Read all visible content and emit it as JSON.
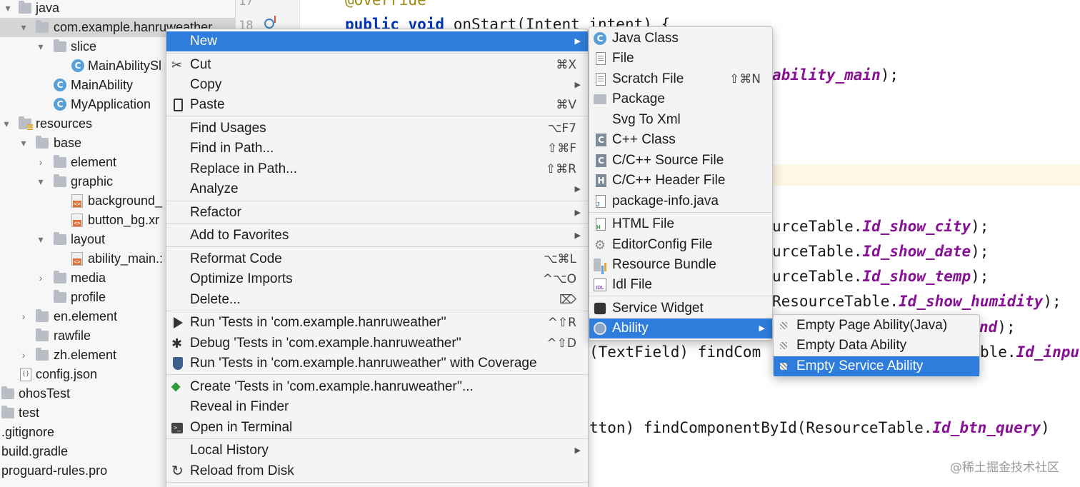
{
  "tree": {
    "items": [
      {
        "label": "java",
        "icon": "folder-icon",
        "arrow": "▾"
      },
      {
        "label": "com.example.hanruweather",
        "icon": "package-icon",
        "arrow": "▾"
      },
      {
        "label": "slice",
        "icon": "package-icon",
        "arrow": "▾"
      },
      {
        "label": "MainAbilitySl",
        "icon": "class-icon",
        "arrow": ""
      },
      {
        "label": "MainAbility",
        "icon": "class-icon",
        "arrow": ""
      },
      {
        "label": "MyApplication",
        "icon": "class-icon",
        "arrow": ""
      },
      {
        "label": "resources",
        "icon": "resources-folder-icon",
        "arrow": "▾"
      },
      {
        "label": "base",
        "icon": "folder-icon",
        "arrow": "▾"
      },
      {
        "label": "element",
        "icon": "folder-icon",
        "arrow": "›"
      },
      {
        "label": "graphic",
        "icon": "folder-icon",
        "arrow": "▾"
      },
      {
        "label": "background_",
        "icon": "xml-file-icon",
        "arrow": ""
      },
      {
        "label": "button_bg.xr",
        "icon": "xml-file-icon",
        "arrow": ""
      },
      {
        "label": "layout",
        "icon": "folder-icon",
        "arrow": "▾"
      },
      {
        "label": "ability_main.:",
        "icon": "xml-file-icon",
        "arrow": ""
      },
      {
        "label": "media",
        "icon": "folder-icon",
        "arrow": "›"
      },
      {
        "label": "profile",
        "icon": "folder-icon",
        "arrow": ""
      },
      {
        "label": "en.element",
        "icon": "folder-icon",
        "arrow": "›"
      },
      {
        "label": "rawfile",
        "icon": "folder-icon",
        "arrow": ""
      },
      {
        "label": "zh.element",
        "icon": "folder-icon",
        "arrow": "›"
      },
      {
        "label": "config.json",
        "icon": "json-file-icon",
        "arrow": ""
      },
      {
        "label": "ohosTest",
        "icon": "folder-icon",
        "arrow": ""
      },
      {
        "label": "test",
        "icon": "folder-icon",
        "arrow": ""
      },
      {
        "label": ".gitignore",
        "icon": "",
        "arrow": ""
      },
      {
        "label": "build.gradle",
        "icon": "",
        "arrow": ""
      },
      {
        "label": "proguard-rules.pro",
        "icon": "",
        "arrow": ""
      }
    ],
    "json_icon_text": "{}"
  },
  "gutter": {
    "lines": [
      "17",
      "18"
    ]
  },
  "editor": {
    "lines": {
      "l0": "@Override",
      "l1_kw": "public void",
      "l1_rest": " onStart(Intent intent) {",
      "l2_fld": "ability_main",
      "l2_rest": ");",
      "l3_pre": "urceTable.",
      "l3_fld": "Id_show_city",
      "l3_post": ");",
      "l4_pre": "urceTable.",
      "l4_fld": "Id_show_date",
      "l4_post": ");",
      "l5_pre": "urceTable.",
      "l5_fld": "Id_show_temp",
      "l5_post": ");",
      "l6_pre": "ResourceTable.",
      "l6_fld": "Id_show_humidity",
      "l6_post": ");",
      "l7_fld": "nd",
      "l7_post": ");",
      "l8_pre": "(TextField) findCom",
      "l8_mid": "ble.",
      "l8_fld": "Id_inpu",
      "l9_pre": "tton) findComponentById(ResourceTable.",
      "l9_fld": "Id_btn_query",
      "l9_post": ")"
    },
    "watermark": "@稀土掘金技术社区"
  },
  "context_menu": {
    "items": [
      {
        "label": "New",
        "shortcut": "",
        "submenu": true,
        "icon": ""
      },
      {
        "label": "Cut",
        "shortcut": "⌘X",
        "submenu": false,
        "icon": "scissors-icon"
      },
      {
        "label": "Copy",
        "shortcut": "",
        "submenu": true,
        "icon": ""
      },
      {
        "label": "Paste",
        "shortcut": "⌘V",
        "submenu": false,
        "icon": "clipboard-icon"
      },
      {
        "label": "Find Usages",
        "shortcut": "⌥F7",
        "submenu": false,
        "icon": ""
      },
      {
        "label": "Find in Path...",
        "shortcut": "⇧⌘F",
        "submenu": false,
        "icon": ""
      },
      {
        "label": "Replace in Path...",
        "shortcut": "⇧⌘R",
        "submenu": false,
        "icon": ""
      },
      {
        "label": "Analyze",
        "shortcut": "",
        "submenu": true,
        "icon": ""
      },
      {
        "label": "Refactor",
        "shortcut": "",
        "submenu": true,
        "icon": ""
      },
      {
        "label": "Add to Favorites",
        "shortcut": "",
        "submenu": true,
        "icon": ""
      },
      {
        "label": "Reformat Code",
        "shortcut": "⌥⌘L",
        "submenu": false,
        "icon": ""
      },
      {
        "label": "Optimize Imports",
        "shortcut": "^⌥O",
        "submenu": false,
        "icon": ""
      },
      {
        "label": "Delete...",
        "shortcut": "⌦",
        "submenu": false,
        "icon": ""
      },
      {
        "label": "Run 'Tests in 'com.example.hanruweather''",
        "shortcut": "^⇧R",
        "submenu": false,
        "icon": "run-icon"
      },
      {
        "label": "Debug 'Tests in 'com.example.hanruweather''",
        "shortcut": "^⇧D",
        "submenu": false,
        "icon": "debug-icon"
      },
      {
        "label": "Run 'Tests in 'com.example.hanruweather'' with Coverage",
        "shortcut": "",
        "submenu": false,
        "icon": "coverage-icon"
      },
      {
        "label": "Create 'Tests in 'com.example.hanruweather''...",
        "shortcut": "",
        "submenu": false,
        "icon": "create-test-icon"
      },
      {
        "label": "Reveal in Finder",
        "shortcut": "",
        "submenu": false,
        "icon": ""
      },
      {
        "label": "Open in Terminal",
        "shortcut": "",
        "submenu": false,
        "icon": "terminal-icon"
      },
      {
        "label": "Local History",
        "shortcut": "",
        "submenu": true,
        "icon": ""
      },
      {
        "label": "Reload from Disk",
        "shortcut": "",
        "submenu": false,
        "icon": "reload-icon"
      }
    ]
  },
  "new_submenu": {
    "items": [
      {
        "label": "Java Class",
        "shortcut": "",
        "icon": "java-class-icon"
      },
      {
        "label": "File",
        "shortcut": "",
        "icon": "file-icon"
      },
      {
        "label": "Scratch File",
        "shortcut": "⇧⌘N",
        "icon": "scratch-file-icon"
      },
      {
        "label": "Package",
        "shortcut": "",
        "icon": "package-icon"
      },
      {
        "label": "Svg To Xml",
        "shortcut": "",
        "icon": ""
      },
      {
        "label": "C++ Class",
        "shortcut": "",
        "icon": "cpp-class-icon"
      },
      {
        "label": "C/C++ Source File",
        "shortcut": "",
        "icon": "cpp-source-icon"
      },
      {
        "label": "C/C++ Header File",
        "shortcut": "",
        "icon": "cpp-header-icon"
      },
      {
        "label": "package-info.java",
        "shortcut": "",
        "icon": "java-file-icon"
      },
      {
        "label": "HTML File",
        "shortcut": "",
        "icon": "html-file-icon"
      },
      {
        "label": "EditorConfig File",
        "shortcut": "",
        "icon": "gear-icon"
      },
      {
        "label": "Resource Bundle",
        "shortcut": "",
        "icon": "resource-bundle-icon"
      },
      {
        "label": "Idl File",
        "shortcut": "",
        "icon": "idl-file-icon"
      },
      {
        "label": "Service Widget",
        "shortcut": "",
        "icon": "puzzle-icon"
      },
      {
        "label": "Ability",
        "shortcut": "",
        "icon": "ability-icon",
        "submenu": true
      }
    ],
    "icon_text": {
      "c": "C",
      "cpp": "C",
      "h": "H",
      "j": "J",
      "html": "H",
      "idl": "IDL",
      "gear": "⚙"
    }
  },
  "ability_submenu": {
    "items": [
      {
        "label": "Empty Page Ability(Java)"
      },
      {
        "label": "Empty Data Ability"
      },
      {
        "label": "Empty Service Ability"
      }
    ]
  },
  "colors": {
    "selection_blue": "#2e7ddc",
    "keyword": "#0033b3",
    "field": "#871094",
    "annotation": "#9e880d"
  }
}
